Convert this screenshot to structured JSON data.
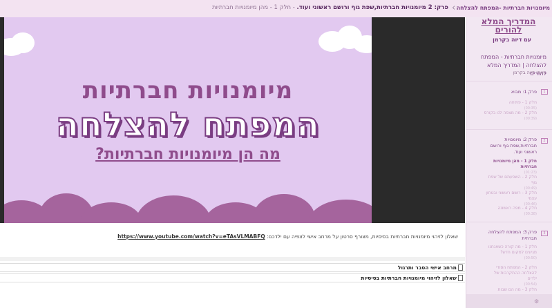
{
  "header": {
    "nav_icon": "chevron-left-icon",
    "breadcrumb_bold": "פרק: 2 מיומנויות חברתיות,שפת גוף ורושם ראשוני ועוד.",
    "breadcrumb_rest": " - חלק 1 - מהן מיומנויות חברתיות",
    "course_title": "מיומנויות חברתיות -המפתח להצלחה"
  },
  "video": {
    "line1": "מיומנויות חברתיות",
    "line2": "המפתח להצלחה",
    "line3": "מה הן מיומנויות חברתיות?"
  },
  "description": {
    "text": "שאלון לזיהוי מיומנויות חברתיות בסיסיות, מצורף סרטון על מרחב אישי לצפיה עם ילדכם:",
    "link": "https://www.youtube.com/watch?v=eTAsVLMABFQ"
  },
  "resources": [
    {
      "label": "מרחב אישי הסבר ותרגול",
      "icon": "document-icon"
    },
    {
      "label": "שאלון לזיהוי מיומנויות חברתיות בסיסיות",
      "icon": "document-icon"
    }
  ],
  "sidebar": {
    "title": "המדריך המלא להורים",
    "subtitle": "עם דיוה בקרמן",
    "course_name": "מיומנויות חברתיות - המפתח להצלחה | המדריך המלא להורים",
    "author": "מאת: דיוה בקרמן",
    "chapters": [
      {
        "num": "1",
        "title": "פרק 1: מבוא",
        "lessons": [
          {
            "label": "חלק 1 - פתיחה",
            "duration": "(00:35)"
          },
          {
            "label": "חלק 2 - מה מצפה לנו בקורס",
            "duration": "(00:39)"
          }
        ]
      },
      {
        "num": "2",
        "title": "פרק 2: מיומנויות חברתיות,שפת גוף ורושם ראשוני ועוד.",
        "lessons": [
          {
            "label": "חלק 1 - מהן מיומנויות חברתיות",
            "duration": "(01:23)"
          },
          {
            "label": "חלק 2 - השפעתם של שפת גוף",
            "duration": "(00:49)"
          },
          {
            "label": "חלק 3 - רושם ראשוני ובטחון עצמי",
            "duration": "(00:46)"
          },
          {
            "label": "חלק 4 - מפה ראשונה",
            "duration": "(00:38)"
          }
        ]
      },
      {
        "num": "3",
        "title": "פרק 3: המפתח להצלחה חברתית",
        "lessons": [
          {
            "label": "חלק 1 - מה קורה כשאנחנו מגיעים למקום חדש?",
            "duration": "(00:50)"
          },
          {
            "label": "חלק 2 - המפתח הסודי להצלחה ההתקרבות של ילדים",
            "duration": "(00:54)"
          },
          {
            "label": "חלק 3 - מה הם שבות",
            "duration": ""
          }
        ]
      }
    ],
    "footer_icon": "gear-icon"
  },
  "colors": {
    "accent": "#8f4c8c",
    "header_bg": "#f3e3f1",
    "video_bg": "#e2c9f0",
    "cloud_purple": "#a5649d"
  }
}
